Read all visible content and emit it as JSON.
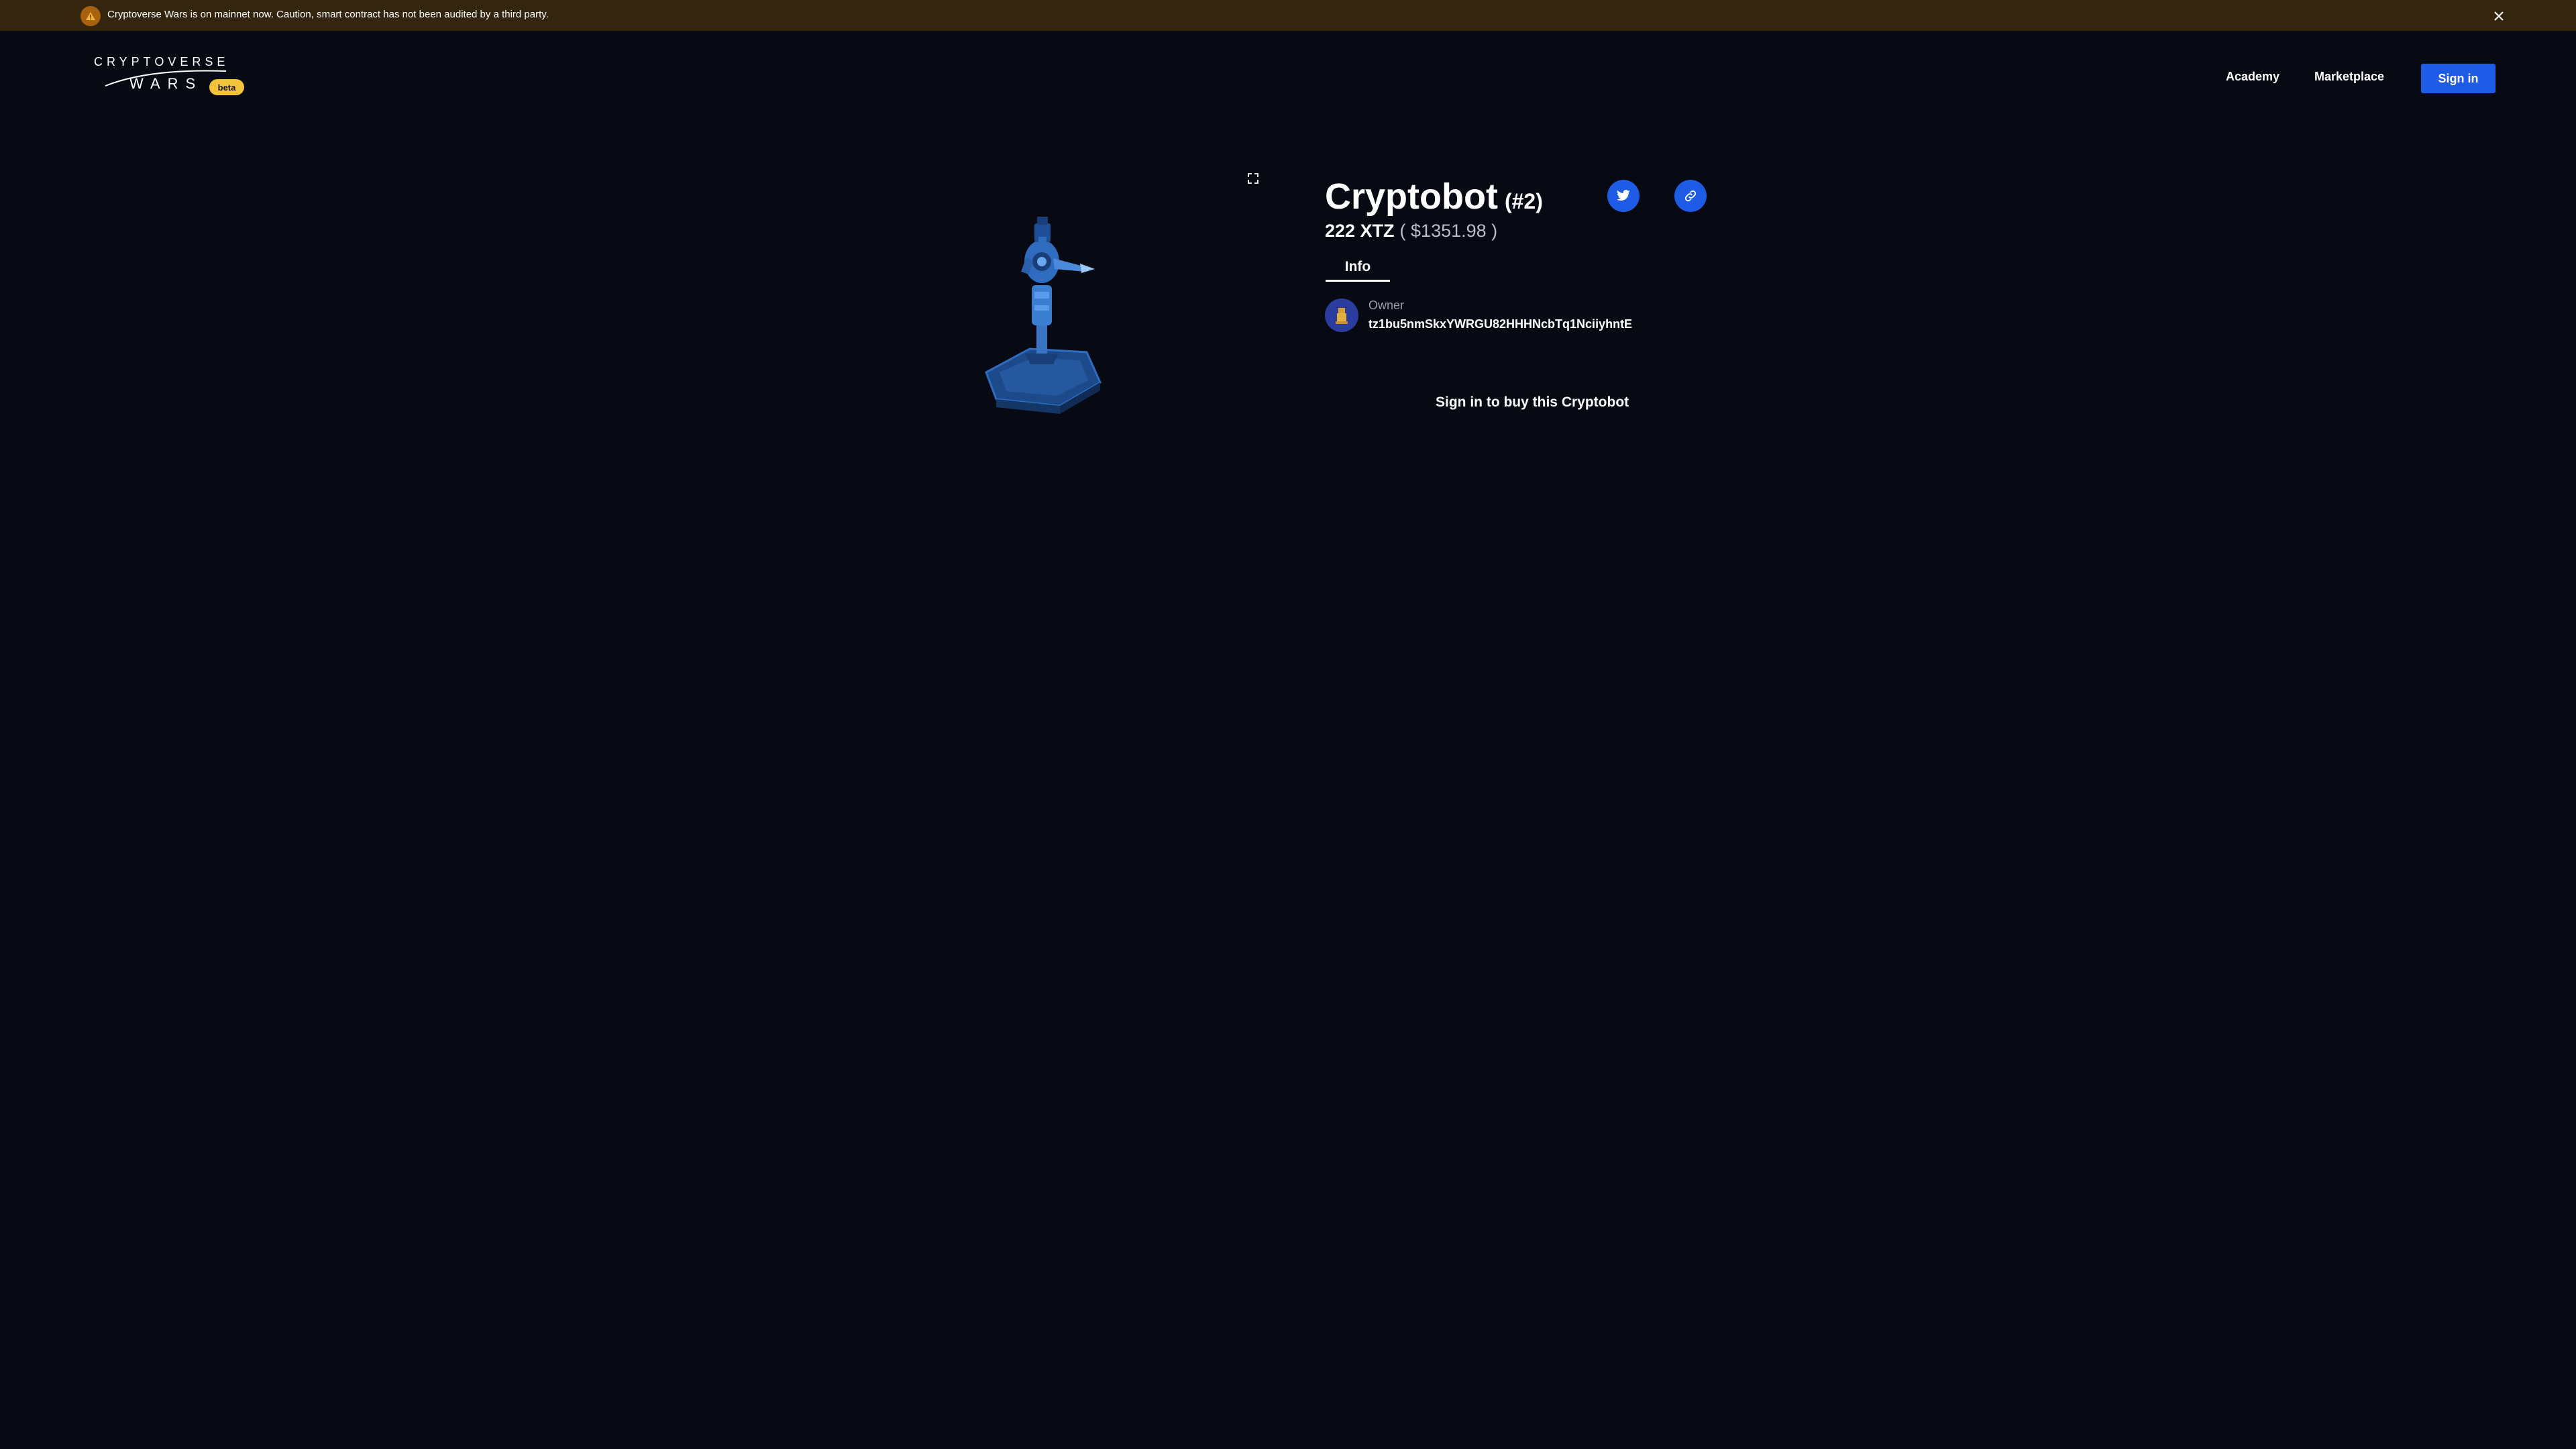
{
  "banner": {
    "icon": "warning-icon",
    "text": "Cryptoverse Wars is on mainnet now. Caution, smart contract has not been audited by a third party.",
    "close_icon": "close-icon"
  },
  "header": {
    "logo_top": "CRYPTOVERSE",
    "logo_bottom": "WARS",
    "badge": "beta",
    "nav": {
      "academy": "Academy",
      "marketplace": "Marketplace"
    },
    "signin_label": "Sign in"
  },
  "item": {
    "name": "Cryptobot",
    "id_label": "(#2)",
    "price_xtz": "222 XTZ",
    "price_usd": "( $1351.98 )",
    "tabs": [
      "Info"
    ],
    "owner_label": "Owner",
    "owner_address": "tz1bu5nmSkxYWRGU82HHHNcbTq1NciiyhntE",
    "buy_prompt": "Sign in to buy this Cryptobot",
    "share_icons": [
      "twitter-icon",
      "link-icon"
    ],
    "expand_icon": "expand-icon"
  },
  "colors": {
    "background": "#070a12",
    "banner": "#34250f",
    "accent": "#1f5ce6",
    "beta": "#f3c43b"
  }
}
